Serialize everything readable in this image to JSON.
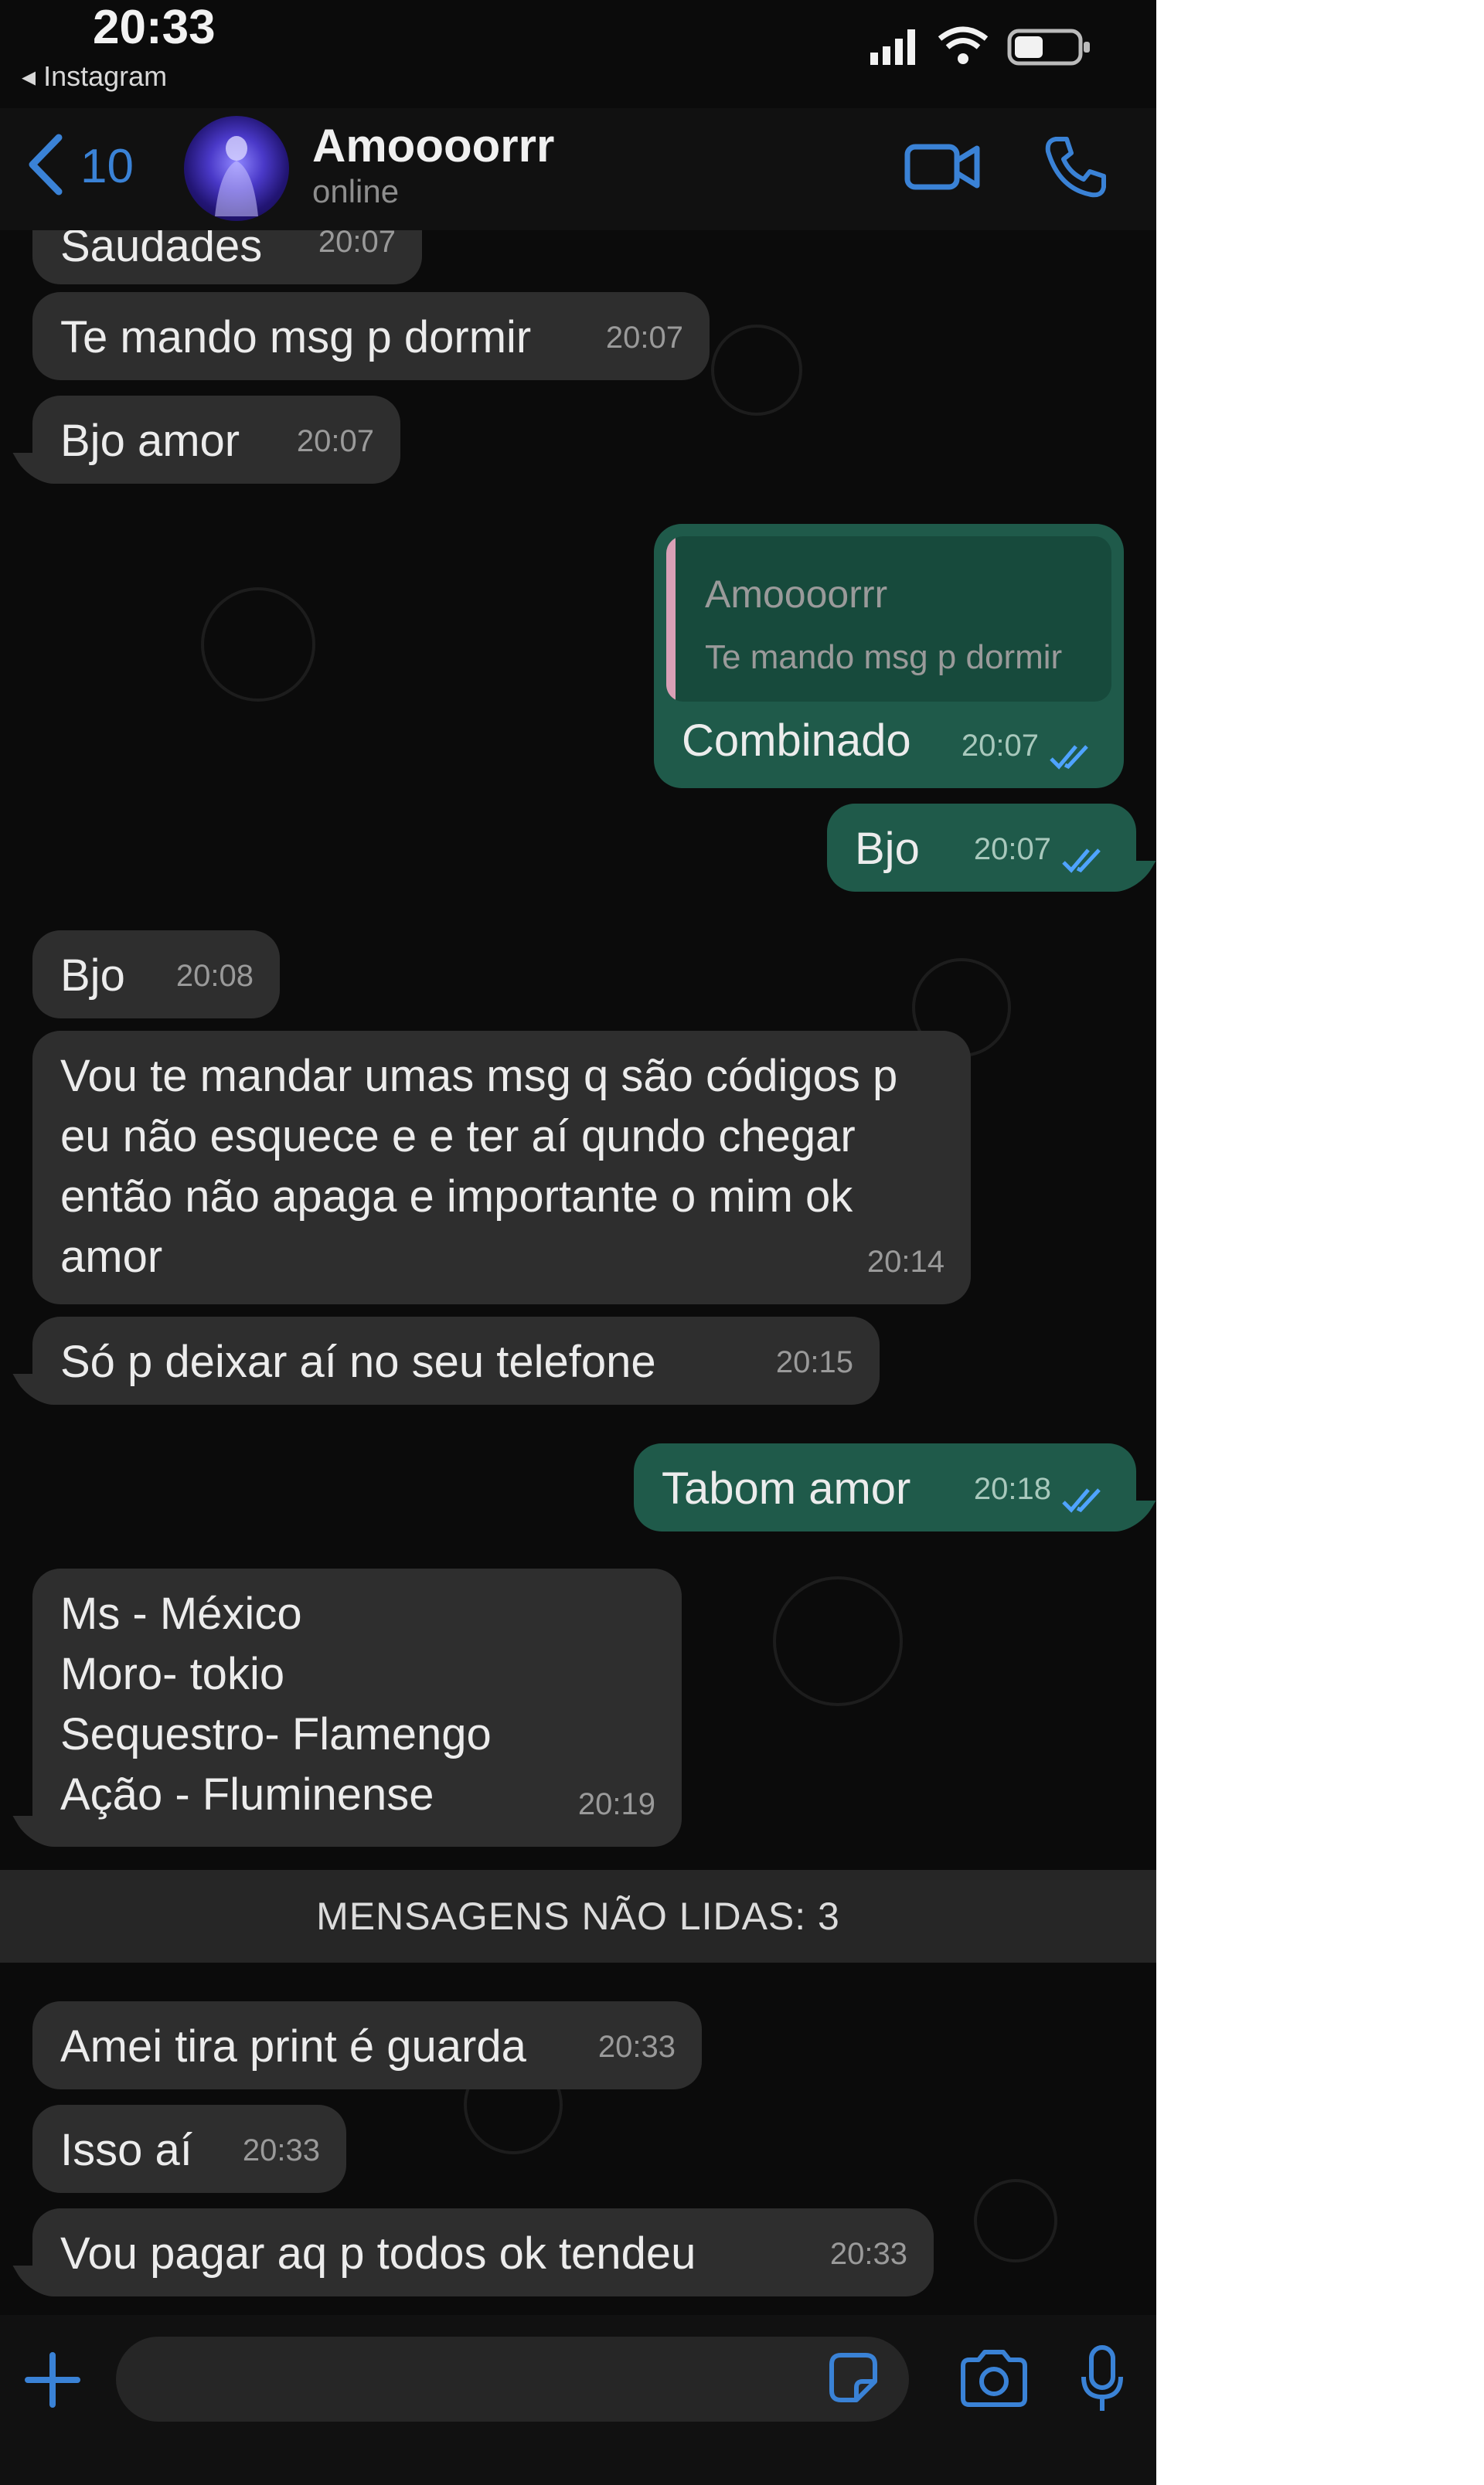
{
  "status_bar": {
    "time": "20:33",
    "back_app": "◂ Instagram"
  },
  "header": {
    "back_count": "10",
    "contact_name": "Amoooorrr",
    "contact_status": "online"
  },
  "messages": [
    {
      "text": "Saudades",
      "time": "20:07"
    },
    {
      "text": "Te mando msg p dormir",
      "time": "20:07"
    },
    {
      "text": "Bjo amor",
      "time": "20:07"
    },
    {
      "quote_author": "Amoooorrr",
      "quote_text": "Te mando msg p dormir",
      "text": "Combinado",
      "time": "20:07"
    },
    {
      "text": "Bjo",
      "time": "20:07"
    },
    {
      "text": "Bjo",
      "time": "20:08"
    },
    {
      "text": "Vou te mandar umas msg q são códigos p\neu não esquece e e ter aí qundo chegar\nentão não apaga e importante o mim ok\namor",
      "time": "20:14"
    },
    {
      "text": "Só p deixar aí no seu telefone",
      "time": "20:15"
    },
    {
      "text": "Tabom amor",
      "time": "20:18"
    },
    {
      "text": "Ms - México\nMoro- tokio\nSequestro- Flamengo\nAção - Fluminense",
      "time": "20:19"
    },
    {
      "text": "Amei tira print é guarda",
      "time": "20:33"
    },
    {
      "text": "Isso aí",
      "time": "20:33"
    },
    {
      "text": "Vou pagar aq p todos ok tendeu",
      "time": "20:33"
    }
  ],
  "unread_divider": "MENSAGENS NÃO LIDAS: 3",
  "colors": {
    "accent": "#3a82d6",
    "incoming_bubble": "#2e2e2e",
    "outgoing_bubble": "#1f5a4a",
    "read_ticks": "#4fa3ff"
  },
  "icons": [
    "back-chevron-icon",
    "video-call-icon",
    "phone-call-icon",
    "plus-icon",
    "sticker-icon",
    "camera-icon",
    "microphone-icon",
    "double-check-icon"
  ]
}
